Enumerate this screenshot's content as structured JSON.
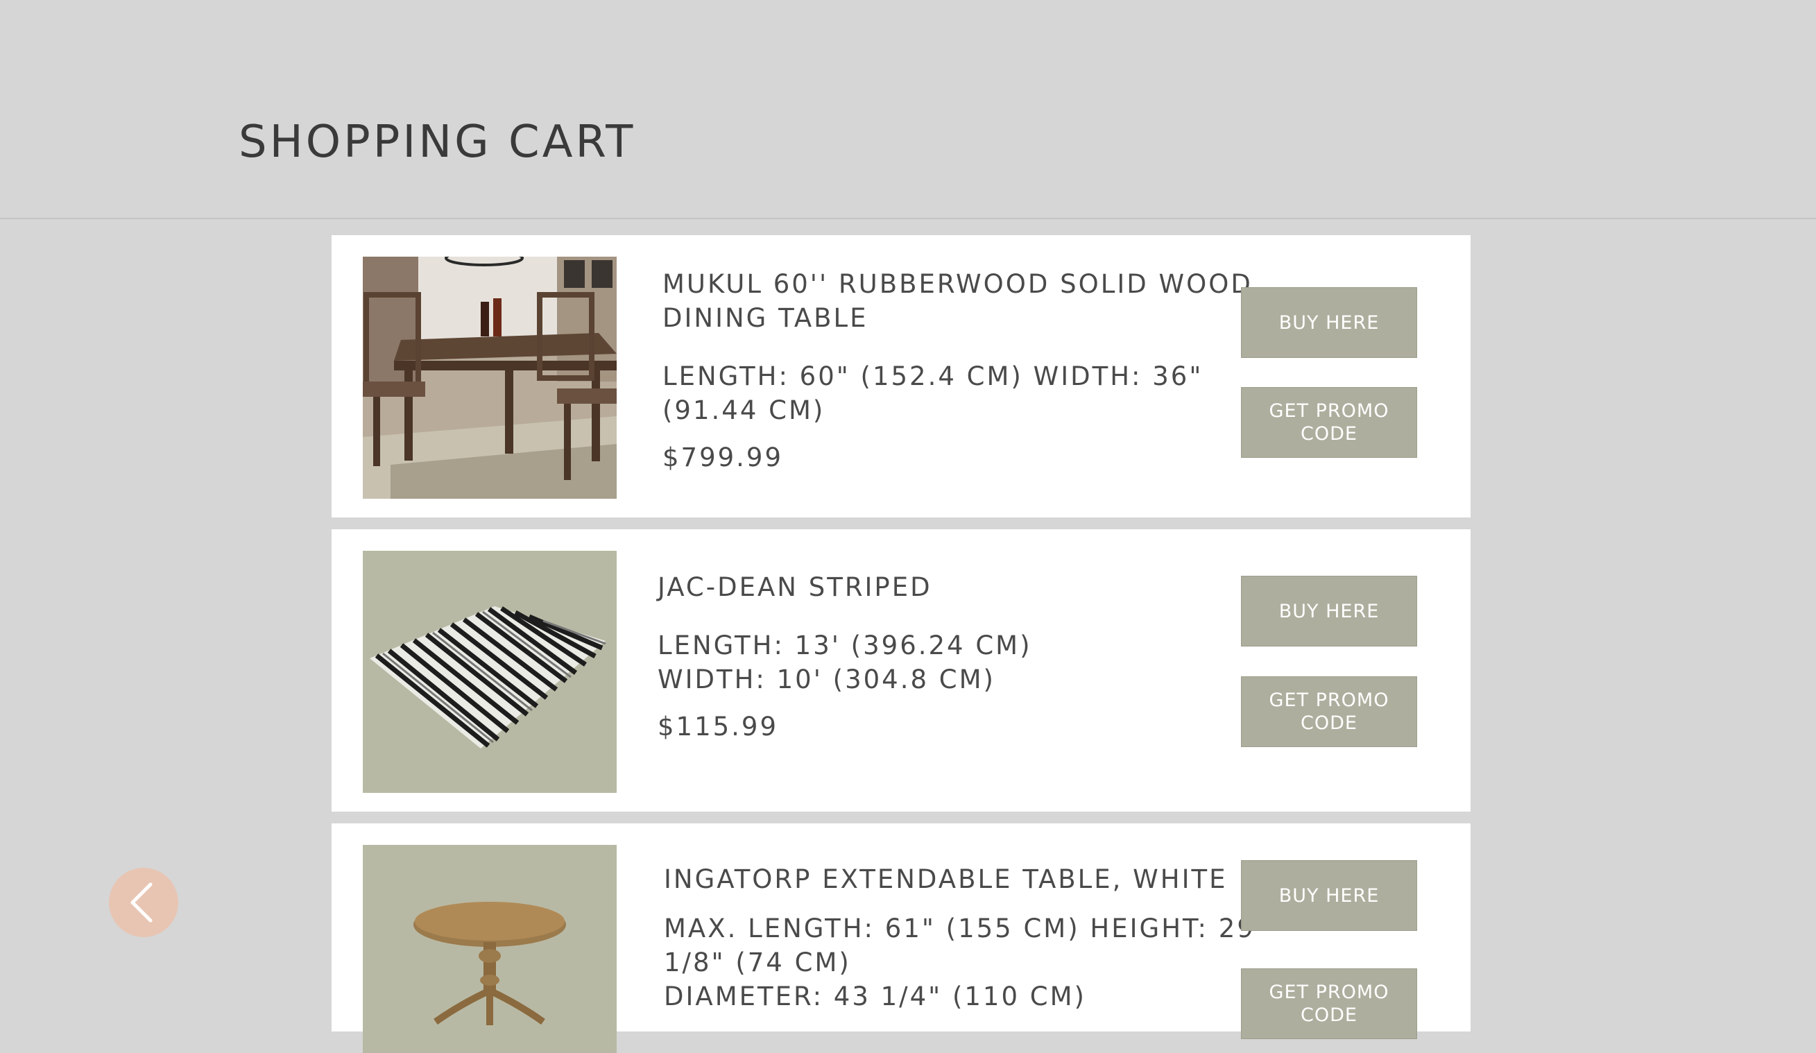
{
  "header": {
    "title": "SHOPPING CART"
  },
  "items": [
    {
      "name_lines": [
        "MUKUL 60'' RUBBERWOOD SOLID WOOD",
        "DINING TABLE"
      ],
      "dimension_lines": [
        "LENGTH: 60\" (152.4 CM) WIDTH: 36\"",
        "(91.44 CM)"
      ],
      "price": "$799.99",
      "image_icon": "dining-table-photo",
      "buy_label": "BUY HERE",
      "promo_label": "GET PROMO CODE"
    },
    {
      "name_lines": [
        "JAC-DEAN STRIPED"
      ],
      "dimension_lines": [
        "LENGTH: 13' (396.24 CM)",
        "WIDTH: 10' (304.8 CM)"
      ],
      "price": "$115.99",
      "image_icon": "striped-rug-photo",
      "buy_label": "BUY HERE",
      "promo_label": "GET PROMO CODE"
    },
    {
      "name_lines": [
        "INGATORP EXTENDABLE TABLE, WHITE"
      ],
      "dimension_lines": [
        "MAX. LENGTH: 61\" (155 CM) HEIGHT: 29",
        "1/8\" (74 CM)",
        "DIAMETER: 43 1/4\" (110 CM)"
      ],
      "price": "",
      "image_icon": "round-pedestal-table-photo",
      "buy_label": "BUY HERE",
      "promo_label": "GET PROMO CODE"
    }
  ],
  "navigation": {
    "back_icon": "chevron-left-icon"
  },
  "colors": {
    "background": "#d6d6d6",
    "card": "#ffffff",
    "button": "#aeae9e",
    "back_button": "#e8c5b3",
    "text": "#4a4a4a"
  }
}
